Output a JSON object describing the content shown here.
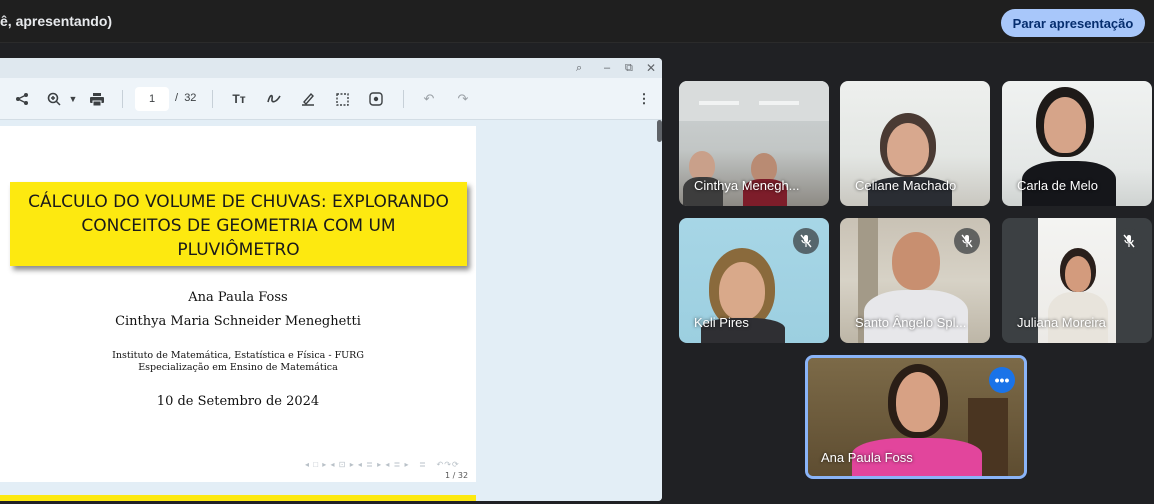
{
  "topbar": {
    "title": "ê, apresentando)",
    "stop_label": "Parar apresentação"
  },
  "pdf": {
    "page_current": "1",
    "page_separator": "/",
    "page_total": "32",
    "slide": {
      "title_line1": "CÁLCULO DO VOLUME DE CHUVAS: EXPLORANDO",
      "title_line2": "CONCEITOS DE GEOMETRIA COM UM",
      "title_line3": "PLUVIÔMETRO",
      "author1": "Ana Paula Foss",
      "author2": "Cinthya Maria Schneider Meneghetti",
      "institute": "Instituto de Matemática, Estatística e Física - FURG",
      "course": "Especialização em Ensino de Matemática",
      "date": "10 de Setembro de 2024",
      "page_indicator": "1 / 32"
    }
  },
  "participants": [
    {
      "name": "Cinthya Menegh...",
      "muted": false
    },
    {
      "name": "Celiane Machado",
      "muted": false
    },
    {
      "name": "Carla de Melo",
      "muted": false
    },
    {
      "name": "Keli Pires",
      "muted": true
    },
    {
      "name": "Santo Ângelo Spl...",
      "muted": true
    },
    {
      "name": "Juliana Moreira",
      "muted": true
    }
  ],
  "presenter": {
    "name": "Ana Paula Foss"
  },
  "colors": {
    "accent": "#a8c7fa",
    "slide_title_bg": "#fde910",
    "highlight": "#8ab4f8"
  }
}
